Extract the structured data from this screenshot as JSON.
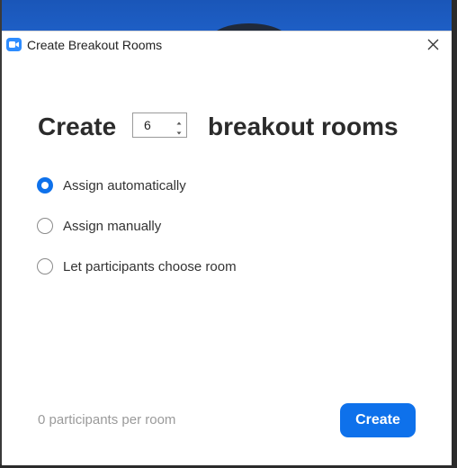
{
  "window": {
    "title": "Create Breakout Rooms"
  },
  "headline": {
    "prefix": "Create",
    "room_count": "6",
    "suffix": "breakout rooms"
  },
  "options": [
    {
      "label": "Assign automatically",
      "selected": true
    },
    {
      "label": "Assign manually",
      "selected": false
    },
    {
      "label": "Let participants choose room",
      "selected": false
    }
  ],
  "footer": {
    "participants_per_room": "0 participants per room",
    "create_label": "Create"
  },
  "colors": {
    "accent": "#0e71eb",
    "app_icon": "#2d8cff",
    "muted_text": "#9a9a9a"
  },
  "icons": {
    "app": "zoom-camera-icon",
    "close": "close-icon",
    "up": "chevron-up-icon",
    "down": "chevron-down-icon"
  }
}
